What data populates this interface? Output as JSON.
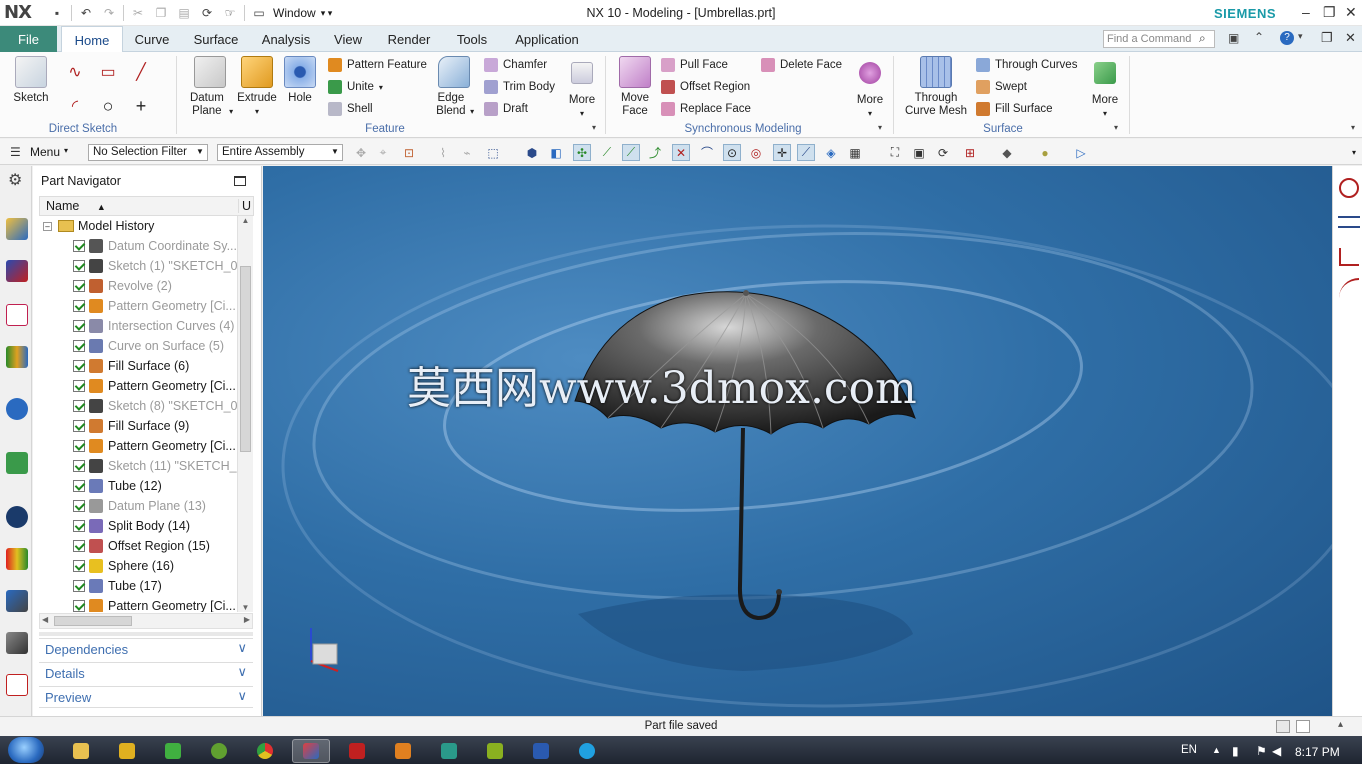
{
  "app": {
    "logo": "NX",
    "window_menu": "Window",
    "title": "NX 10 - Modeling - [Umbrellas.prt]",
    "brand": "SIEMENS"
  },
  "tabs": {
    "file": "File",
    "items": [
      "Home",
      "Curve",
      "Surface",
      "Analysis",
      "View",
      "Render",
      "Tools",
      "Application"
    ],
    "active": "Home"
  },
  "search": {
    "placeholder": "Find a Command"
  },
  "ribbon": {
    "direct_sketch": {
      "label": "Direct Sketch",
      "sketch": "Sketch"
    },
    "feature": {
      "label": "Feature",
      "datum_plane": "Datum Plane",
      "extrude": "Extrude",
      "hole": "Hole",
      "pattern_feature": "Pattern Feature",
      "unite": "Unite",
      "shell": "Shell",
      "edge_blend": "Edge Blend",
      "chamfer": "Chamfer",
      "trim_body": "Trim Body",
      "draft": "Draft",
      "more": "More"
    },
    "synchronous": {
      "label": "Synchronous Modeling",
      "move_face": "Move Face",
      "pull_face": "Pull Face",
      "offset_region": "Offset Region",
      "replace_face": "Replace Face",
      "delete_face": "Delete Face",
      "more": "More"
    },
    "surface": {
      "label": "Surface",
      "through_curve_mesh": "Through Curve Mesh",
      "through_curves": "Through Curves",
      "swept": "Swept",
      "fill_surface": "Fill Surface",
      "more": "More"
    }
  },
  "selection_bar": {
    "menu": "Menu",
    "filter": "No Selection Filter",
    "scope": "Entire Assembly"
  },
  "navigator": {
    "title": "Part Navigator",
    "column": "Name",
    "column2": "U",
    "root": "Model History",
    "items": [
      {
        "label": "Datum Coordinate Sy...",
        "dim": true,
        "icon": "datum-csys-icon",
        "color": "#555555"
      },
      {
        "label": "Sketch (1) \"SKETCH_0...",
        "dim": true,
        "icon": "sketch-icon",
        "color": "#444444"
      },
      {
        "label": "Revolve (2)",
        "dim": true,
        "icon": "revolve-icon",
        "color": "#c06030"
      },
      {
        "label": "Pattern Geometry [Ci...",
        "dim": true,
        "icon": "pattern-icon",
        "color": "#e08a20"
      },
      {
        "label": "Intersection Curves (4)",
        "dim": true,
        "icon": "intersection-icon",
        "color": "#8a8aa8"
      },
      {
        "label": "Curve on Surface (5)",
        "dim": true,
        "icon": "curve-on-surface-icon",
        "color": "#6a7ab0"
      },
      {
        "label": "Fill Surface (6)",
        "dim": false,
        "icon": "fill-surface-icon",
        "color": "#d07a30"
      },
      {
        "label": "Pattern Geometry [Ci...",
        "dim": false,
        "icon": "pattern-icon",
        "color": "#e08a20"
      },
      {
        "label": "Sketch (8) \"SKETCH_0...",
        "dim": true,
        "icon": "sketch-icon",
        "color": "#444444"
      },
      {
        "label": "Fill Surface (9)",
        "dim": false,
        "icon": "fill-surface-icon",
        "color": "#d07a30"
      },
      {
        "label": "Pattern Geometry [Ci...",
        "dim": false,
        "icon": "pattern-icon",
        "color": "#e08a20"
      },
      {
        "label": "Sketch (11) \"SKETCH_...",
        "dim": true,
        "icon": "sketch-icon",
        "color": "#444444"
      },
      {
        "label": "Tube (12)",
        "dim": false,
        "icon": "tube-icon",
        "color": "#6a7ab8"
      },
      {
        "label": "Datum Plane (13)",
        "dim": true,
        "icon": "datum-plane-icon",
        "color": "#999999"
      },
      {
        "label": "Split Body (14)",
        "dim": false,
        "icon": "split-body-icon",
        "color": "#7a6ab8"
      },
      {
        "label": "Offset Region (15)",
        "dim": false,
        "icon": "offset-region-icon",
        "color": "#c05050"
      },
      {
        "label": "Sphere (16)",
        "dim": false,
        "icon": "sphere-icon",
        "color": "#e8c020"
      },
      {
        "label": "Tube (17)",
        "dim": false,
        "icon": "tube-icon",
        "color": "#6a7ab8"
      },
      {
        "label": "Pattern Geometry [Ci...",
        "dim": false,
        "icon": "pattern-icon",
        "color": "#e08a20"
      }
    ],
    "panels": [
      "Dependencies",
      "Details",
      "Preview"
    ]
  },
  "viewport": {
    "watermark": "莫西网www.3dmox.com"
  },
  "status": {
    "message": "Part file saved"
  },
  "taskbar": {
    "lang": "EN",
    "time": "8:17 PM"
  }
}
